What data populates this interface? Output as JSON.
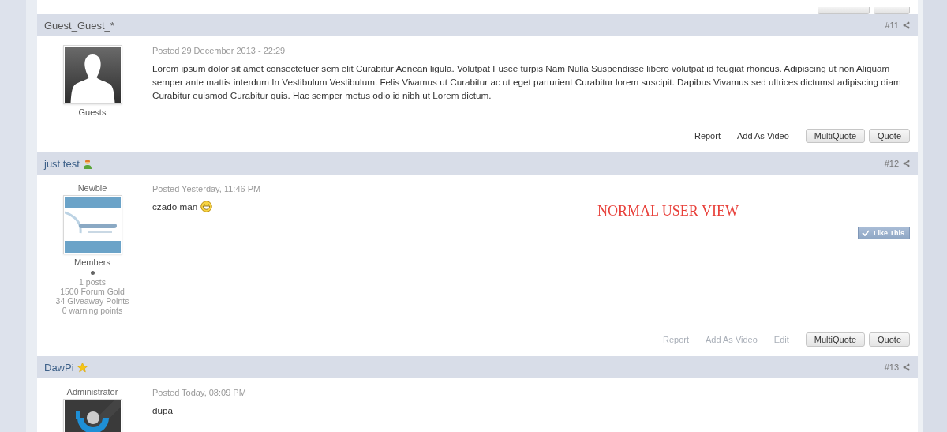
{
  "posts": [
    {
      "author": {
        "name": "Guest_Guest_*",
        "kind": "guest",
        "group": "Guests",
        "avatar": {
          "kind": "silhouette"
        }
      },
      "number": "#11",
      "posted": "Posted 29 December 2013 - 22:29",
      "message": "Lorem ipsum dolor sit amet consectetuer sem elit Curabitur Aenean ligula. Volutpat Fusce turpis Nam Nulla Suspendisse libero volutpat id feugiat rhoncus. Adipiscing ut non Aliquam semper ante mattis interdum In Vestibulum Vestibulum. Felis Vivamus ut Curabitur ac ut eget parturient Curabitur lorem suscipit. Dapibus Vivamus sed ultrices dictumst adipiscing diam Curabitur euismod Curabitur quis. Hac semper metus odio id nibh ut Lorem dictum.",
      "actions": [
        {
          "label": "Report",
          "kind": "link",
          "disabled": false
        },
        {
          "label": "Add As Video",
          "kind": "link",
          "disabled": false
        },
        {
          "label": "MultiQuote",
          "kind": "button"
        },
        {
          "label": "Quote",
          "kind": "button"
        }
      ]
    },
    {
      "author": {
        "name": "just test",
        "kind": "member",
        "rank_icon": {
          "kind": "person"
        },
        "title": "Newbie",
        "group": "Members",
        "avatar": {
          "kind": "picture"
        },
        "online": false,
        "stats": [
          "1 posts",
          "1500 Forum Gold",
          "34 Giveaway Points",
          "0 warning points"
        ]
      },
      "number": "#12",
      "posted": "Posted Yesterday, 11:46 PM",
      "message": "czado man",
      "emoticon": {
        "kind": "grin"
      },
      "note": "NORMAL USER VIEW",
      "like": "Like This",
      "actions": [
        {
          "label": "Report",
          "kind": "link",
          "disabled": true
        },
        {
          "label": "Add As Video",
          "kind": "link",
          "disabled": true
        },
        {
          "label": "Edit",
          "kind": "link",
          "disabled": true
        },
        {
          "label": "MultiQuote",
          "kind": "button"
        },
        {
          "label": "Quote",
          "kind": "button"
        }
      ]
    },
    {
      "author": {
        "name": "DawPi",
        "kind": "member",
        "rank_icon": {
          "kind": "star"
        },
        "title": "Administrator",
        "avatar": {
          "kind": "picture"
        }
      },
      "number": "#13",
      "posted": "Posted Today, 08:09 PM",
      "message": "dupa"
    }
  ]
}
